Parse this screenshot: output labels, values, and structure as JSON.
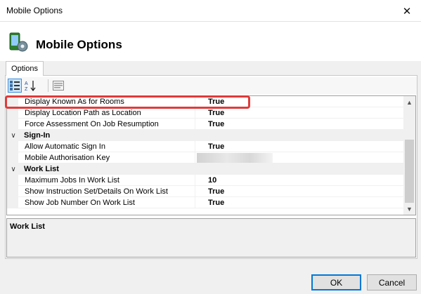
{
  "window": {
    "title": "Mobile Options",
    "close_icon": "close-icon"
  },
  "header": {
    "title": "Mobile Options",
    "icon": "mobile-settings-icon"
  },
  "tabs": [
    {
      "label": "Options"
    }
  ],
  "toolbar": {
    "categorized_icon": "categorized-view-icon",
    "alphabetical_icon": "sort-az-icon",
    "property_pages_icon": "property-pages-icon"
  },
  "grid": {
    "rows": [
      {
        "type": "property",
        "name": "Display Known As for Rooms",
        "value": "True"
      },
      {
        "type": "property",
        "name": "Display Location Path as Location",
        "value": "True"
      },
      {
        "type": "property",
        "name": "Force Assessment On Job Resumption",
        "value": "True"
      },
      {
        "type": "category",
        "name": "Sign-In"
      },
      {
        "type": "property",
        "name": "Allow Automatic Sign In",
        "value": "True"
      },
      {
        "type": "property",
        "name": "Mobile Authorisation Key",
        "value": ""
      },
      {
        "type": "category",
        "name": "Work List"
      },
      {
        "type": "property",
        "name": "Maximum Jobs In Work List",
        "value": "10"
      },
      {
        "type": "property",
        "name": "Show Instruction Set/Details On Work List",
        "value": "True"
      },
      {
        "type": "property",
        "name": "Show Job Number On Work List",
        "value": "True"
      }
    ]
  },
  "description": {
    "title": "Work List"
  },
  "buttons": {
    "ok": "OK",
    "cancel": "Cancel"
  },
  "colors": {
    "highlight": "#e03b3b",
    "accent": "#0078d7"
  }
}
